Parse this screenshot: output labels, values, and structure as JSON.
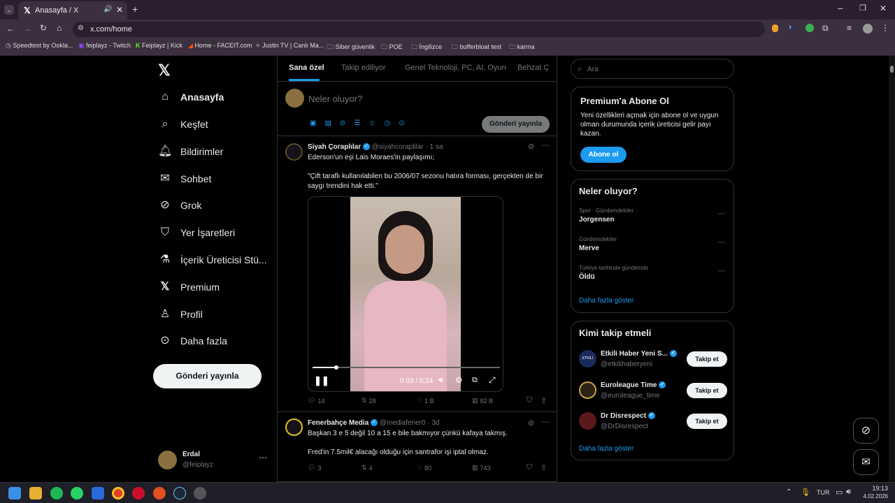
{
  "browser": {
    "tab_title": "Anasayfa / X",
    "url": "x.com/home",
    "bookmarks": [
      "Speedtest by Ookla...",
      "feiplayz - Twitch",
      "Feiplayz | Kick",
      "Home - FACEIT.com",
      "Justin TV | Canlı Ma...",
      "Siber güvenlik",
      "POE",
      "İngilizce",
      "bufferbloat test",
      "karma"
    ]
  },
  "sidebar": {
    "items": [
      {
        "label": "Anasayfa",
        "icon": "home-icon"
      },
      {
        "label": "Keşfet",
        "icon": "search-icon"
      },
      {
        "label": "Bildirimler",
        "icon": "bell-icon"
      },
      {
        "label": "Sohbet",
        "icon": "mail-icon"
      },
      {
        "label": "Grok",
        "icon": "grok-icon"
      },
      {
        "label": "Yer İşaretleri",
        "icon": "bookmark-icon"
      },
      {
        "label": "İçerik Üreticisi Stü...",
        "icon": "flask-icon"
      },
      {
        "label": "Premium",
        "icon": "x-icon"
      },
      {
        "label": "Profil",
        "icon": "person-icon"
      },
      {
        "label": "Daha fazla",
        "icon": "more-circle-icon"
      }
    ],
    "post_button": "Gönderi yayınla",
    "user": {
      "name": "Erdal",
      "handle": "@feiplayz"
    }
  },
  "timeline": {
    "tabs": [
      "Sana özel",
      "Takip ediliyor",
      "Genel Teknoloji, PC, AI, Oyun",
      "Behzat Ç"
    ],
    "compose_placeholder": "Neler oluyor?",
    "compose_button": "Gönderi yayınla",
    "posts": [
      {
        "name": "Siyah Çoraplılar",
        "handle": "@siyahcoraplilar",
        "time": "· 1 sa",
        "line1": "Ederson'un eşi Lais Moraes'in paylaşımı;",
        "line2": "\"Çift taraflı kullanılabilen bu 2006/07 sezonu hatıra forması, gerçekten de bir saygı trendini hak etti.\"",
        "video_time": "0:03 / 0:24",
        "video_progress": 0.125,
        "replies": "14",
        "reposts": "28",
        "likes": "1 B",
        "views": "82 B"
      },
      {
        "name": "Fenerbahçe Media",
        "handle": "@mediafener0",
        "time": "· 3d",
        "line1": "Başkan 3 e 5 değil 10 a 15 e bile bakmıyor çünkü kafaya takmış.",
        "line2": "Fred'in 7.5mil€ alacağı olduğu için santrafor işi iptal olmaz.",
        "replies": "3",
        "reposts": "4",
        "likes": "80",
        "views": "743"
      }
    ]
  },
  "right": {
    "search_placeholder": "Ara",
    "premium": {
      "title": "Premium'a Abone Ol",
      "text": "Yeni özellikleri açmak için abone ol ve uygun olman durumunda içerik üreticisi gelir payı kazan.",
      "button": "Abone ol"
    },
    "trends": {
      "title": "Neler oluyor?",
      "items": [
        {
          "category": "Spor · Gündemdekiler",
          "name": "Jorgensen"
        },
        {
          "category": "Gündemdekiler",
          "name": "Merve"
        },
        {
          "category": "Türkiye tarihinde gündemde",
          "name": "Öldü"
        }
      ],
      "more": "Daha fazla göster"
    },
    "who_to_follow": {
      "title": "Kimi takip etmeli",
      "users": [
        {
          "name": "Etkili Haber Yeni S...",
          "handle": "@etkilihaberyeni"
        },
        {
          "name": "Euroleague Time",
          "handle": "@euroleague_time"
        },
        {
          "name": "Dr Disrespect",
          "handle": "@DrDisrespect"
        }
      ],
      "button": "Takip et",
      "more": "Daha fazla göster"
    }
  },
  "taskbar": {
    "lang": "TUR",
    "time": "19:13",
    "date": "4.02.2026"
  }
}
